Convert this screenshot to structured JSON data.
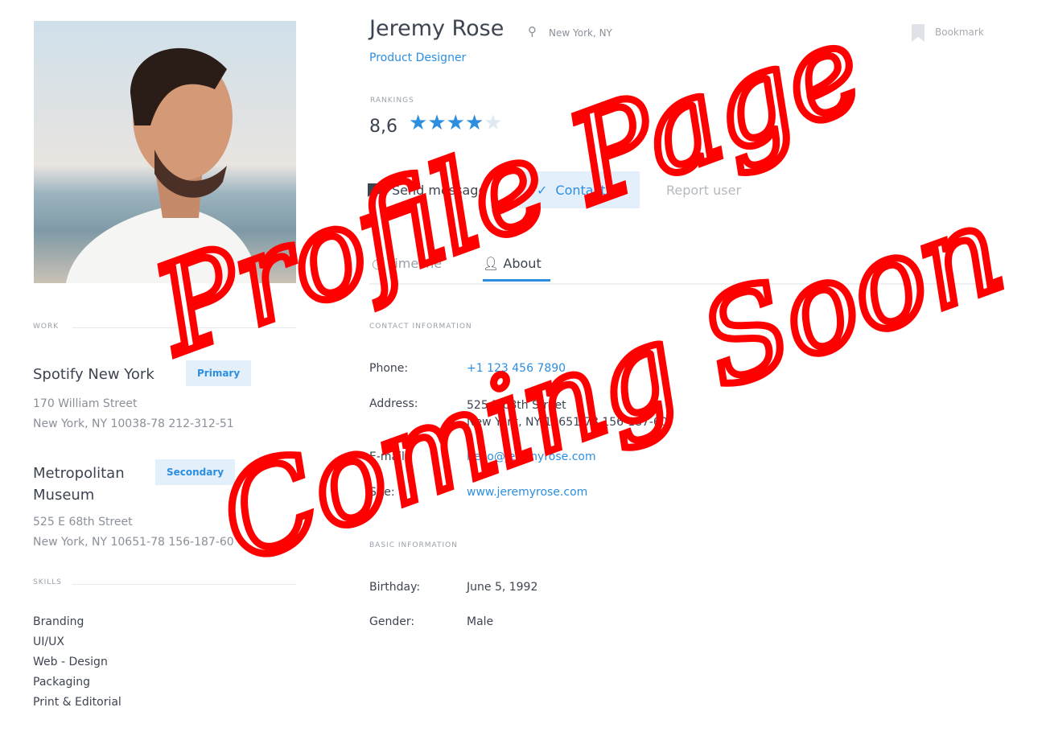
{
  "profile": {
    "name": "Jeremy Rose",
    "location": "New York, NY",
    "title": "Product Designer",
    "bookmark": "Bookmark",
    "rankings_label": "Rankings",
    "rating": "8,6",
    "stars": 4,
    "stars_max": 5
  },
  "actions": {
    "send_message": "Send message",
    "contacts": "Contacts",
    "report": "Report user"
  },
  "tabs": [
    {
      "label": "Timeline"
    },
    {
      "label": "About",
      "active": true
    }
  ],
  "work": {
    "label": "Work",
    "items": [
      {
        "name": "Spotify New York",
        "badge": "Primary",
        "line1": "170 William Street",
        "line2": "New York, NY 10038-78 212-312-51"
      },
      {
        "name": "Metropolitan Museum",
        "badge": "Secondary",
        "line1": "525 E 68th Street",
        "line2": "New York, NY 10651-78 156-187-60"
      }
    ]
  },
  "skills": {
    "label": "Skills",
    "items": [
      "Branding",
      "UI/UX",
      "Web - Design",
      "Packaging",
      "Print & Editorial"
    ]
  },
  "contact": {
    "label": "Contact Information",
    "phone_label": "Phone:",
    "phone": "+1 123 456 7890",
    "address_label": "Address:",
    "address1": "525 E 68th Street",
    "address2": "New York, NY 10651-78 156-187-60",
    "email_label": "E-mail:",
    "email": "hello@jeremyrose.com",
    "site_label": "Site:",
    "site": "www.jeremyrose.com"
  },
  "basic": {
    "label": "Basic Information",
    "birthday_label": "Birthday:",
    "birthday": "June 5, 1992",
    "gender_label": "Gender:",
    "gender": "Male"
  },
  "overlay": {
    "line1": "Profile Page",
    "line2": "Coming Soon",
    "color": "#ff0000"
  },
  "colors": {
    "accent": "#2d8ee0"
  }
}
